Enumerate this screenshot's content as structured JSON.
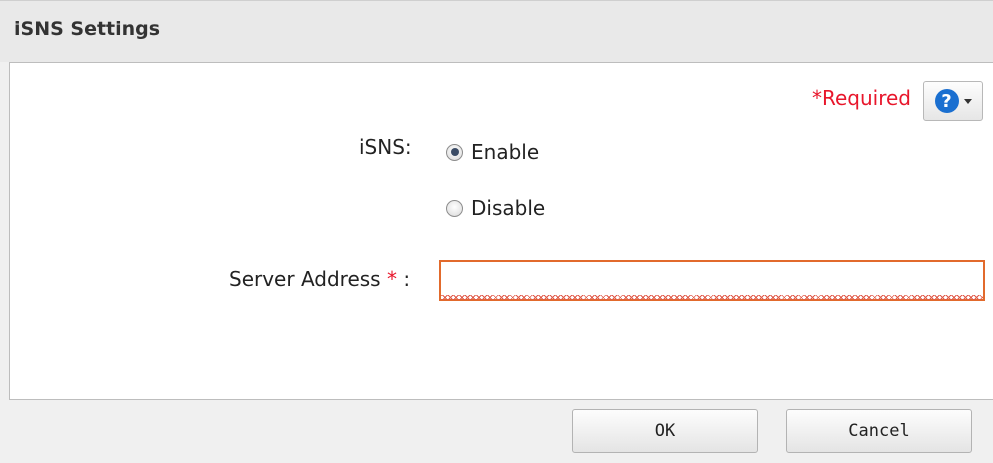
{
  "dialog": {
    "title": "iSNS Settings"
  },
  "header": {
    "required_note": "*Required",
    "help_glyph": "?",
    "help_icon": "question-circle-icon"
  },
  "form": {
    "isns_label": "iSNS:",
    "options": [
      {
        "label": "Enable",
        "checked": true
      },
      {
        "label": "Disable",
        "checked": false
      }
    ],
    "server_address_label": "Server Address",
    "required_star": "*",
    "colon": ":",
    "server_address_value": ""
  },
  "buttons": {
    "ok": "OK",
    "cancel": "Cancel"
  },
  "colors": {
    "required": "#e8162b",
    "input_error_border": "#e26a2c",
    "help_icon": "#1a6fd0"
  }
}
